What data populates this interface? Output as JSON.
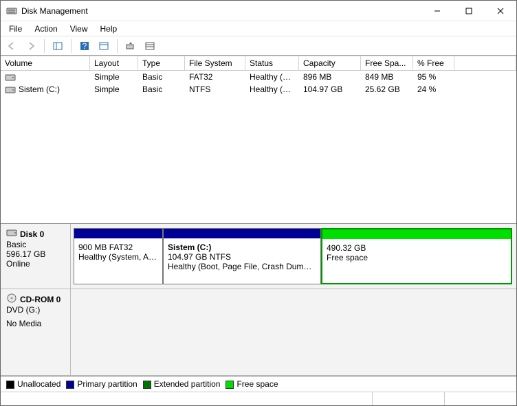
{
  "window": {
    "title": "Disk Management"
  },
  "menu": {
    "file": "File",
    "action": "Action",
    "view": "View",
    "help": "Help"
  },
  "columns": {
    "volume": "Volume",
    "layout": "Layout",
    "type": "Type",
    "filesystem": "File System",
    "status": "Status",
    "capacity": "Capacity",
    "freespace": "Free Spa...",
    "pctfree": "% Free"
  },
  "volumes": [
    {
      "name": "",
      "layout": "Simple",
      "type": "Basic",
      "fs": "FAT32",
      "status": "Healthy (S...",
      "capacity": "896 MB",
      "free": "849 MB",
      "pct": "95 %"
    },
    {
      "name": "Sistem (C:)",
      "layout": "Simple",
      "type": "Basic",
      "fs": "NTFS",
      "status": "Healthy (B...",
      "capacity": "104.97 GB",
      "free": "25.62 GB",
      "pct": "24 %"
    }
  ],
  "disk0": {
    "title": "Disk 0",
    "kind": "Basic",
    "size": "596.17 GB",
    "state": "Online",
    "p0": {
      "line1": "",
      "line2": "900 MB FAT32",
      "line3": "Healthy (System, Activ"
    },
    "p1": {
      "line1": "Sistem  (C:)",
      "line2": "104.97 GB NTFS",
      "line3": "Healthy (Boot, Page File, Crash Dump, Pr"
    },
    "p2": {
      "line1": "",
      "line2": "490.32 GB",
      "line3": "Free space"
    }
  },
  "cdrom": {
    "title": "CD-ROM 0",
    "kind": "DVD (G:)",
    "state": "No Media"
  },
  "legend": {
    "unallocated": "Unallocated",
    "primary": "Primary partition",
    "extended": "Extended partition",
    "freespace": "Free space"
  }
}
